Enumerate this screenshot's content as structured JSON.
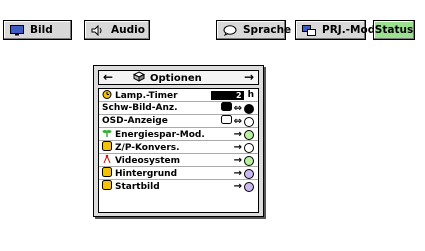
{
  "tabs": [
    {
      "label": "Bild"
    },
    {
      "label": "Audio"
    },
    {
      "label": "Sprache"
    },
    {
      "label": "PRJ.-Mode"
    },
    {
      "label": "Status"
    }
  ],
  "menu": {
    "title": "Optionen",
    "rows": [
      {
        "label": "Lamp.-Timer",
        "value": "2",
        "unit": "h"
      },
      {
        "label": "Schw-Bild-Anz."
      },
      {
        "label": "OSD-Anzeige"
      },
      {
        "label": "Energiespar-Mod."
      },
      {
        "label": "Z/P-Konvers."
      },
      {
        "label": "Videosystem"
      },
      {
        "label": "Hintergrund"
      },
      {
        "label": "Startbild"
      }
    ]
  },
  "colors": {
    "active_tab": "#9be08f",
    "tab_background": "#d8d8d8",
    "menu_background": "#dcdcdc"
  }
}
